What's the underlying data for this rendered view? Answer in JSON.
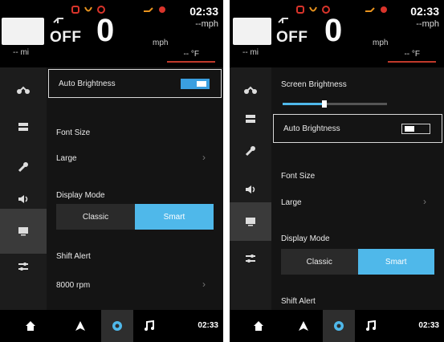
{
  "colors": {
    "accent": "#4fb8ea",
    "warning_red": "#d9342b",
    "warning_orange": "#e8931e",
    "background": "#141414"
  },
  "screenA": {
    "header": {
      "odometer_value": "",
      "trip": "-- mi",
      "gear": "OFF",
      "speed": "0",
      "speed_unit": "mph",
      "clock": "02:33",
      "speed2": "--mph",
      "temperature": "-- °F"
    },
    "sidebar": [
      "motorcycle-icon",
      "dashboard-layout-icon",
      "wrench-icon",
      "speaker-icon",
      "display-icon",
      "sliders-icon"
    ],
    "settings": {
      "auto_brightness": {
        "label": "Auto Brightness",
        "on": true
      },
      "font_size": {
        "label": "Font Size",
        "value": "Large",
        "chevron": "›"
      },
      "display_mode": {
        "label": "Display Mode",
        "options": [
          "Classic",
          "Smart"
        ],
        "selected": "Smart"
      },
      "shift_alert": {
        "label": "Shift Alert",
        "value": "8000 rpm",
        "chevron": "›"
      }
    },
    "nav": {
      "time": "02:33",
      "selected": "settings"
    }
  },
  "screenB": {
    "header": {
      "odometer_value": "",
      "trip": "-- mi",
      "gear": "OFF",
      "speed": "0",
      "speed_unit": "mph",
      "clock": "02:33",
      "speed2": "--mph",
      "temperature": "-- °F"
    },
    "settings": {
      "screen_brightness": {
        "label": "Screen Brightness",
        "level_fraction": 0.4
      },
      "auto_brightness": {
        "label": "Auto Brightness",
        "on": false
      },
      "font_size": {
        "label": "Font Size",
        "value": "Large",
        "chevron": "›"
      },
      "display_mode": {
        "label": "Display Mode",
        "options": [
          "Classic",
          "Smart"
        ],
        "selected": "Smart"
      },
      "shift_alert": {
        "label": "Shift Alert"
      }
    },
    "nav": {
      "time": "02:33",
      "selected": "settings"
    }
  }
}
